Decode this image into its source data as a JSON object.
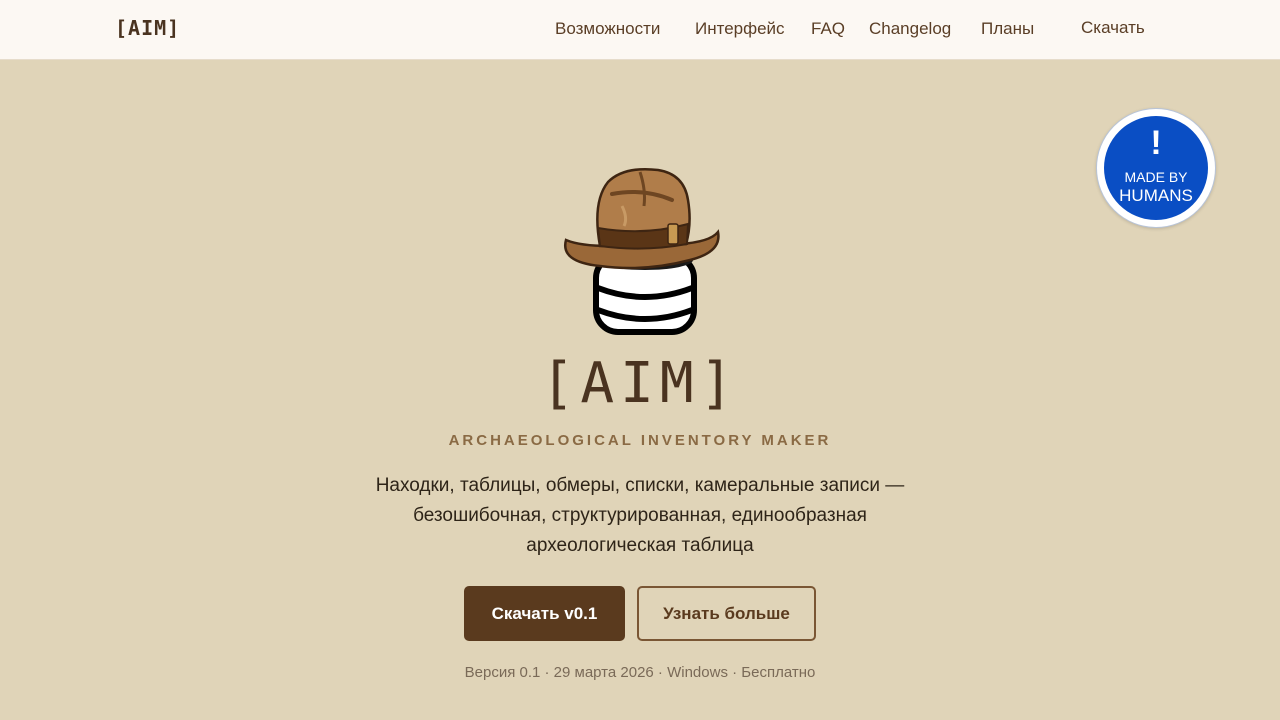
{
  "header": {
    "logo": "[AIM]",
    "nav": [
      {
        "label": "Возможности"
      },
      {
        "label": "Интерфейс"
      },
      {
        "label": "FAQ"
      },
      {
        "label": "Changelog"
      },
      {
        "label": "Планы"
      }
    ],
    "download_link": "Скачать"
  },
  "badge": {
    "mark": "!",
    "line1": "MADE BY",
    "line2": "HUMANS"
  },
  "hero": {
    "title": "[AIM]",
    "subtitle": "ARCHAEOLOGICAL INVENTORY MAKER",
    "description": "Находки, таблицы, обмеры, списки, камеральные записи — безошибочная, структурированная, единообразная археологическая таблица",
    "primary_button": "Скачать v0.1",
    "secondary_button": "Узнать больше",
    "meta": "Версия 0.1 · 29 марта 2026 · Windows · Бесплатно"
  },
  "icons": {
    "hero": "fedora-hat-on-database-icon"
  },
  "colors": {
    "background": "#e0d4b8",
    "header_background": "#fcf8f3",
    "accent": "#5a3a1e",
    "badge_blue": "#0a4ec4"
  }
}
